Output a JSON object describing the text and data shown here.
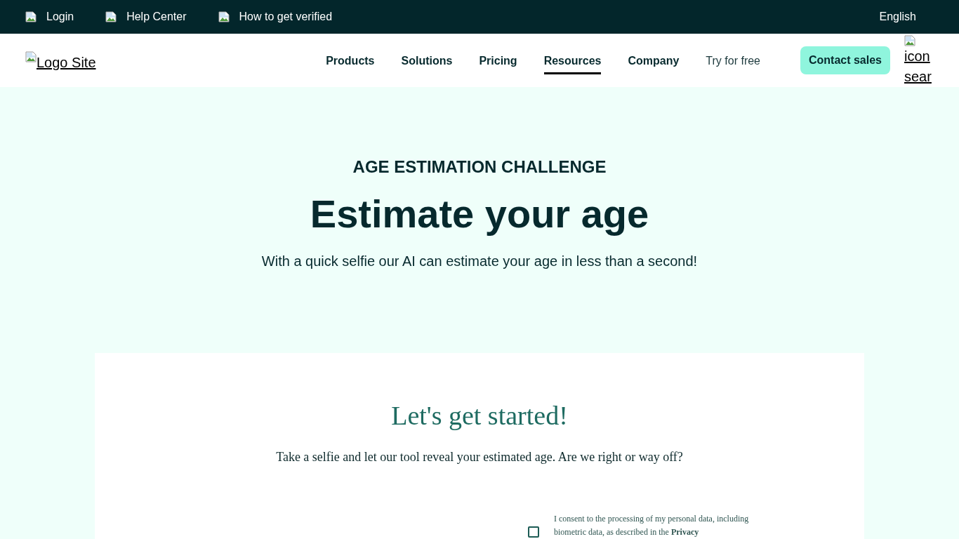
{
  "top_bar": {
    "links": [
      {
        "label": "Login"
      },
      {
        "label": "Help Center"
      },
      {
        "label": "How to get verified"
      }
    ],
    "language": "English"
  },
  "nav": {
    "logo_alt": "Logo Site",
    "items": [
      {
        "label": "Products",
        "kind": "menu",
        "selected": false
      },
      {
        "label": "Solutions",
        "kind": "menu",
        "selected": false
      },
      {
        "label": "Pricing",
        "kind": "menu",
        "selected": false
      },
      {
        "label": "Resources",
        "kind": "menu",
        "selected": true
      },
      {
        "label": "Company",
        "kind": "menu",
        "selected": false
      },
      {
        "label": "Try for free",
        "kind": "link",
        "selected": false
      }
    ],
    "contact_button": "Contact sales",
    "search_alt": "icon sear"
  },
  "hero": {
    "eyebrow": "AGE ESTIMATION CHALLENGE",
    "title": "Estimate your age",
    "subtitle": "With a quick selfie our AI can estimate your age in less than a second!"
  },
  "card": {
    "title": "Let's get started!",
    "intro": "Take a selfie and let our tool reveal your estimated age. Are we right or way off?",
    "consent": {
      "checked": false,
      "text": "I consent to the processing of my personal data, including biometric data, as described in the **Privacy**"
    }
  }
}
